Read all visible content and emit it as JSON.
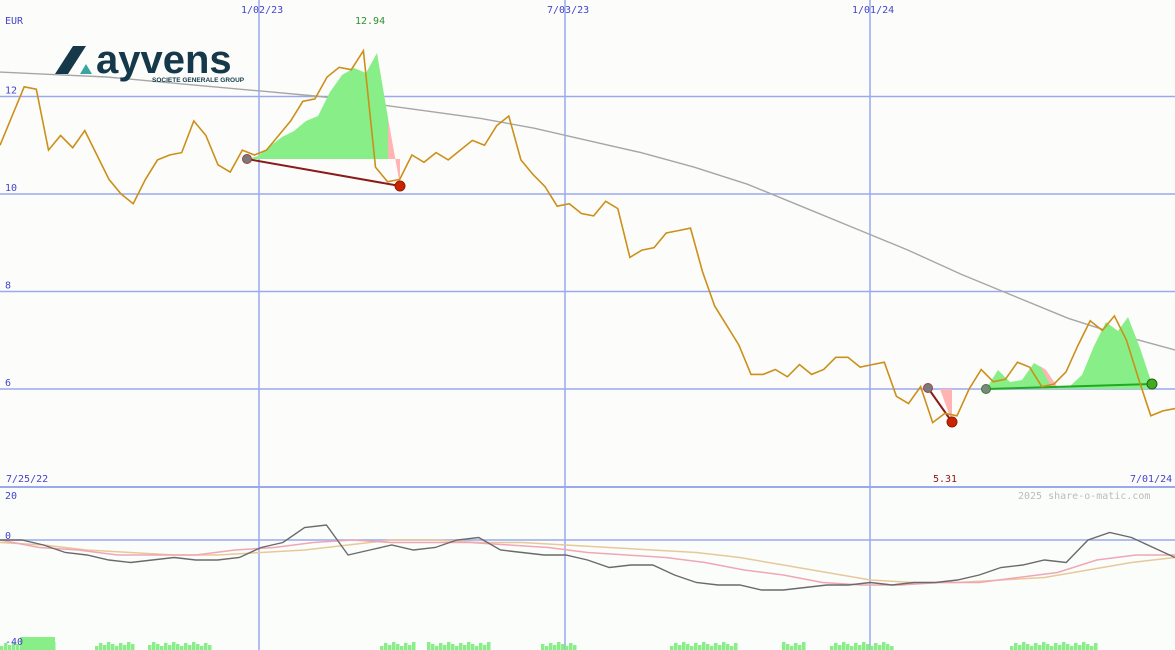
{
  "chart_data": [
    {
      "type": "line",
      "title": "",
      "currency": "EUR",
      "ylim": [
        4,
        14
      ],
      "y_ticks": [
        6,
        8,
        10,
        12
      ],
      "x_ticks": [
        "1/02/23",
        "7/03/23",
        "1/01/24"
      ],
      "date_range_start": "7/25/22",
      "date_range_end": "7/01/24",
      "high_label": "12.94",
      "low_label": "5.31",
      "series": [
        {
          "values": [
            11.0,
            11.6,
            12.2,
            12.15,
            10.9,
            11.2,
            10.95,
            11.3,
            10.8,
            10.3,
            10.0,
            9.8,
            10.3,
            10.7,
            10.8,
            10.85,
            11.5,
            11.2,
            10.6,
            10.45,
            10.9,
            10.8,
            10.9,
            11.2,
            11.5,
            11.9,
            11.95,
            12.4,
            12.6,
            12.55,
            12.94,
            10.55,
            10.25,
            10.3,
            10.8,
            10.65,
            10.85,
            10.7,
            10.9,
            11.1,
            11.0,
            11.4,
            11.6,
            10.7,
            10.4,
            10.15,
            9.75,
            9.8,
            9.6,
            9.55,
            9.85,
            9.7,
            8.7,
            8.85,
            8.9,
            9.2,
            9.25,
            9.3,
            8.4,
            7.7,
            7.3,
            6.9,
            6.3,
            6.3,
            6.4,
            6.25,
            6.5,
            6.3,
            6.4,
            6.65,
            6.65,
            6.45,
            6.5,
            6.55,
            5.85,
            5.7,
            6.05,
            5.31,
            5.5,
            5.45,
            6.0,
            6.4,
            6.15,
            6.2,
            6.55,
            6.45,
            6.05,
            6.1,
            6.35,
            6.9,
            7.4,
            7.2,
            7.5,
            7.0,
            6.2,
            5.45,
            5.55,
            5.6
          ]
        },
        {
          "values": [
            12.5,
            12.45,
            12.4,
            12.3,
            12.2,
            12.1,
            12.0,
            11.85,
            11.7,
            11.55,
            11.35,
            11.1,
            10.85,
            10.55,
            10.2,
            9.75,
            9.3,
            8.85,
            8.35,
            7.9,
            7.45,
            7.1,
            6.8
          ]
        },
        {
          "values": [
            0,
            0,
            -2,
            -5,
            -6,
            -8,
            -9,
            -8,
            -7,
            -8,
            -8,
            -7,
            -3,
            -1,
            5,
            6,
            -6,
            -4,
            -2,
            -4,
            -3,
            0,
            1,
            -4,
            -5,
            -6,
            -6,
            -8,
            -11,
            -10,
            -10,
            -14,
            -17,
            -18,
            -18,
            -20,
            -20,
            -19,
            -18,
            -18,
            -17,
            -18,
            -17,
            -17,
            -16,
            -14,
            -11,
            -10,
            -8,
            -9,
            0,
            3,
            1,
            -3,
            -7
          ]
        },
        {
          "values": [
            0,
            -3,
            -4,
            -6,
            -6,
            -6,
            -4,
            -3,
            -1,
            0,
            -1,
            -1,
            -1,
            -2,
            -3,
            -5,
            -6,
            -7,
            -9,
            -12,
            -14,
            -17,
            -18,
            -18,
            -17,
            -17,
            -15,
            -13,
            -8,
            -6,
            -6
          ]
        },
        {
          "values": [
            -1,
            -2,
            -4,
            -5,
            -6,
            -6,
            -5,
            -4,
            -2,
            0,
            0,
            -1,
            -1,
            -2,
            -3,
            -4,
            -5,
            -7,
            -10,
            -13,
            -16,
            -17,
            -17,
            -16,
            -15,
            -12,
            -9,
            -7
          ]
        }
      ]
    }
  ],
  "watermark": "2025 share-o-matic.com",
  "logo": {
    "name": "ayvens",
    "tagline": "SOCIETE GENERALE GROUP",
    "brand_color": "#15394b",
    "accent_color": "#3aa5a0"
  },
  "colors": {
    "price_line": "#cc8f1a",
    "ma_line": "#a6a6a6",
    "grid": "#9aa8ee",
    "axis_label": "#4444cc",
    "high_label": "#2f8f2f",
    "low_label": "#8b1a1a",
    "gain_fill": "#88ee88",
    "loss_fill": "#ffb3b3",
    "osc_main": "#6a6a6a",
    "osc_fast": "#f0a6b6",
    "osc_slow": "#e8c89a",
    "volume": "#88ee88"
  }
}
